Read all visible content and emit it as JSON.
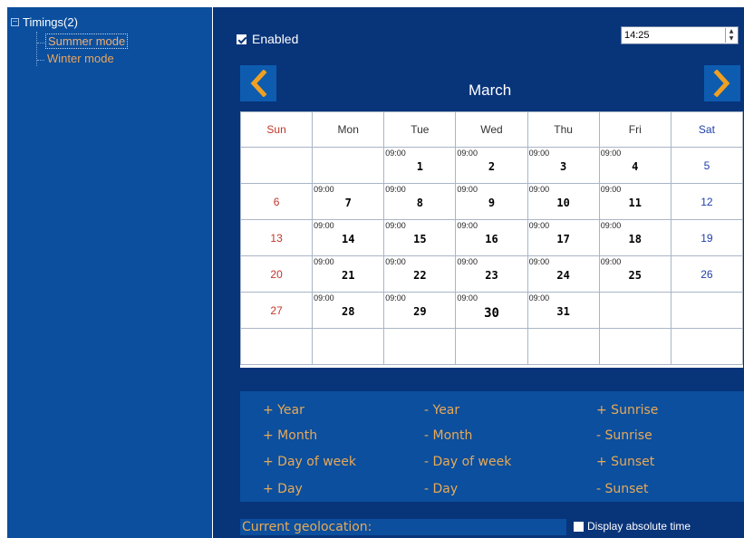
{
  "tree": {
    "root_label": "Timings(2)",
    "toggle_symbol": "−",
    "children": [
      {
        "label": "Summer mode",
        "selected": true
      },
      {
        "label": "Winter mode",
        "selected": false
      }
    ]
  },
  "settings": {
    "enabled_label": "Enabled",
    "enabled_checked": true,
    "time_value": "14:25"
  },
  "calendar": {
    "month": "March",
    "prev_icon": "chevron-left-icon",
    "next_icon": "chevron-right-icon",
    "weekdays": [
      "Sun",
      "Mon",
      "Tue",
      "Wed",
      "Thu",
      "Fri",
      "Sat"
    ],
    "weeks": [
      [
        {
          "day": ""
        },
        {
          "day": ""
        },
        {
          "time": "09:00",
          "day": "1"
        },
        {
          "time": "09:00",
          "day": "2"
        },
        {
          "time": "09:00",
          "day": "3"
        },
        {
          "time": "09:00",
          "day": "4"
        },
        {
          "day": "5"
        }
      ],
      [
        {
          "day": "6"
        },
        {
          "time": "09:00",
          "day": "7"
        },
        {
          "time": "09:00",
          "day": "8"
        },
        {
          "time": "09:00",
          "day": "9"
        },
        {
          "time": "09:00",
          "day": "10"
        },
        {
          "time": "09:00",
          "day": "11"
        },
        {
          "day": "12"
        }
      ],
      [
        {
          "day": "13"
        },
        {
          "time": "09:00",
          "day": "14"
        },
        {
          "time": "09:00",
          "day": "15"
        },
        {
          "time": "09:00",
          "day": "16"
        },
        {
          "time": "09:00",
          "day": "17"
        },
        {
          "time": "09:00",
          "day": "18"
        },
        {
          "day": "19"
        }
      ],
      [
        {
          "day": "20"
        },
        {
          "time": "09:00",
          "day": "21"
        },
        {
          "time": "09:00",
          "day": "22"
        },
        {
          "time": "09:00",
          "day": "23"
        },
        {
          "time": "09:00",
          "day": "24"
        },
        {
          "time": "09:00",
          "day": "25"
        },
        {
          "day": "26"
        }
      ],
      [
        {
          "day": "27"
        },
        {
          "time": "09:00",
          "day": "28"
        },
        {
          "time": "09:00",
          "day": "29"
        },
        {
          "time": "09:00",
          "day": "30"
        },
        {
          "time": "09:00",
          "day": "31"
        },
        {
          "day": ""
        },
        {
          "day": ""
        }
      ],
      [
        {
          "day": ""
        },
        {
          "day": ""
        },
        {
          "day": ""
        },
        {
          "day": ""
        },
        {
          "day": ""
        },
        {
          "day": ""
        },
        {
          "day": ""
        }
      ]
    ],
    "today": "30"
  },
  "actions": {
    "plus_year": "+ Year",
    "minus_year": "- Year",
    "plus_sunrise": "+ Sunrise",
    "plus_month": "+ Month",
    "minus_month": "- Month",
    "minus_sunrise": "- Sunrise",
    "plus_day_of_week": "+ Day of week",
    "minus_day_of_week": "- Day of week",
    "plus_sunset": "+ Sunset",
    "plus_day": "+ Day",
    "minus_day": "- Day",
    "minus_sunset": "- Sunset"
  },
  "footer": {
    "geolocation_label": "Current geolocation:",
    "absolute_time_label": "Display absolute time",
    "absolute_time_checked": false
  },
  "colors": {
    "panel_bg": "#08347a",
    "sidebar_bg": "#0b4f9e",
    "accent_orange": "#e8a957",
    "sunday_red": "#c0362a",
    "saturday_blue": "#1f3fa8"
  }
}
